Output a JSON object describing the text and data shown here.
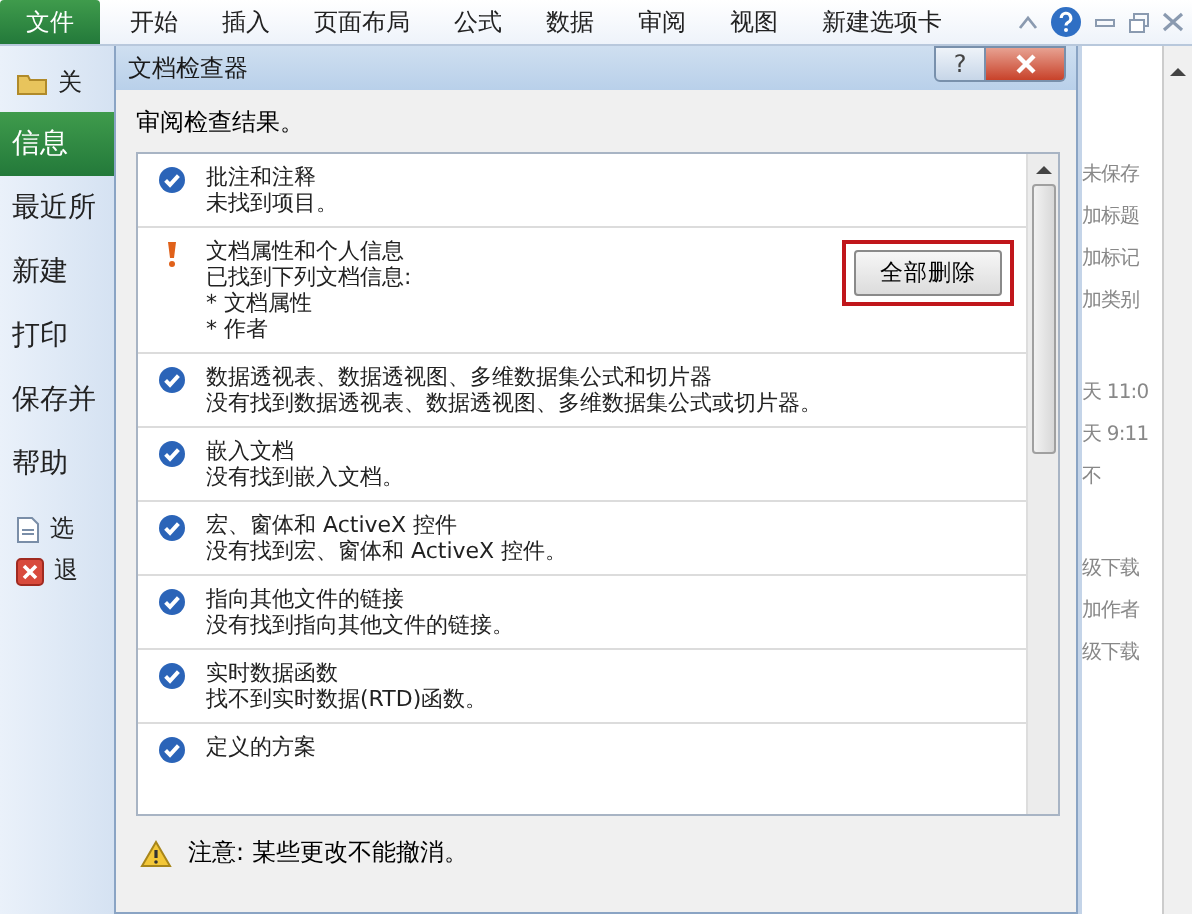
{
  "ribbon": {
    "tabs": [
      {
        "label": "文件",
        "selected": true
      },
      {
        "label": "开始",
        "selected": false
      },
      {
        "label": "插入",
        "selected": false
      },
      {
        "label": "页面布局",
        "selected": false
      },
      {
        "label": "公式",
        "selected": false
      },
      {
        "label": "数据",
        "selected": false
      },
      {
        "label": "审阅",
        "selected": false
      },
      {
        "label": "视图",
        "selected": false
      },
      {
        "label": "新建选项卡",
        "selected": false
      }
    ]
  },
  "backstage": {
    "items": [
      {
        "label": "关",
        "kind": "command",
        "selected": false
      },
      {
        "label": "信息",
        "kind": "page",
        "selected": true
      },
      {
        "label": "最近所",
        "kind": "page",
        "selected": false
      },
      {
        "label": "新建",
        "kind": "page",
        "selected": false
      },
      {
        "label": "打印",
        "kind": "page",
        "selected": false
      },
      {
        "label": "保存并",
        "kind": "page",
        "selected": false
      },
      {
        "label": "帮助",
        "kind": "page",
        "selected": false
      },
      {
        "label": "选",
        "kind": "options",
        "selected": false
      },
      {
        "label": "退",
        "kind": "exit",
        "selected": false
      }
    ]
  },
  "dialog": {
    "title": "文档检查器",
    "help": "?",
    "heading": "审阅检查结果。",
    "results": [
      {
        "issues_found": false,
        "title": "批注和注释",
        "details": [
          "未找到项目。"
        ]
      },
      {
        "issues_found": true,
        "title": "文档属性和个人信息",
        "details": [
          "已找到下列文档信息:",
          "* 文档属性",
          "* 作者"
        ],
        "button": "全部删除",
        "highlighted": true
      },
      {
        "issues_found": false,
        "title": "数据透视表、数据透视图、多维数据集公式和切片器",
        "details": [
          "没有找到数据透视表、数据透视图、多维数据集公式或切片器。"
        ]
      },
      {
        "issues_found": false,
        "title": "嵌入文档",
        "details": [
          "没有找到嵌入文档。"
        ]
      },
      {
        "issues_found": false,
        "title": "宏、窗体和 ActiveX 控件",
        "details": [
          "没有找到宏、窗体和 ActiveX 控件。"
        ]
      },
      {
        "issues_found": false,
        "title": "指向其他文件的链接",
        "details": [
          "没有找到指向其他文件的链接。"
        ]
      },
      {
        "issues_found": false,
        "title": "实时数据函数",
        "details": [
          "找不到实时数据(RTD)函数。"
        ]
      },
      {
        "issues_found": false,
        "title": "定义的方案"
      }
    ],
    "warning": "注意: 某些更改不能撤消。"
  },
  "right_panel": {
    "groups": [
      {
        "lines": [
          "未保存",
          "加标题",
          "加标记",
          "加类别"
        ]
      },
      {
        "lines": [
          "天 11:0",
          "天 9:11",
          "不"
        ]
      },
      {
        "lines": [
          "级下载",
          "加作者",
          "级下载"
        ]
      }
    ]
  }
}
